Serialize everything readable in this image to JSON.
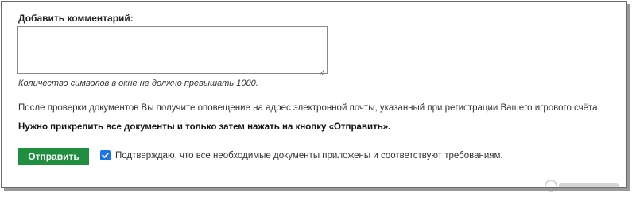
{
  "comment": {
    "label": "Добавить комментарий:",
    "value": "",
    "hint": "Количество символов в окне не должно превышать 1000."
  },
  "notice": "После проверки документов Вы получите оповещение на адрес электронной почты, указанный при регистрации Вашего игрового счёта.",
  "must_attach": "Нужно прикрепить все документы и только затем нажать на кнопку «Отправить».",
  "submit": {
    "label": "Отправить",
    "color": "#1f8f3f"
  },
  "confirm": {
    "checked": true,
    "label": "Подтверждаю, что все необходимые документы приложены и соответствуют требованиям.",
    "color": "#1a73e8"
  },
  "icons": {
    "resize_grip": "resize-grip-icon",
    "checkmark": "checkmark-icon",
    "watermark": "watermark-logo"
  }
}
